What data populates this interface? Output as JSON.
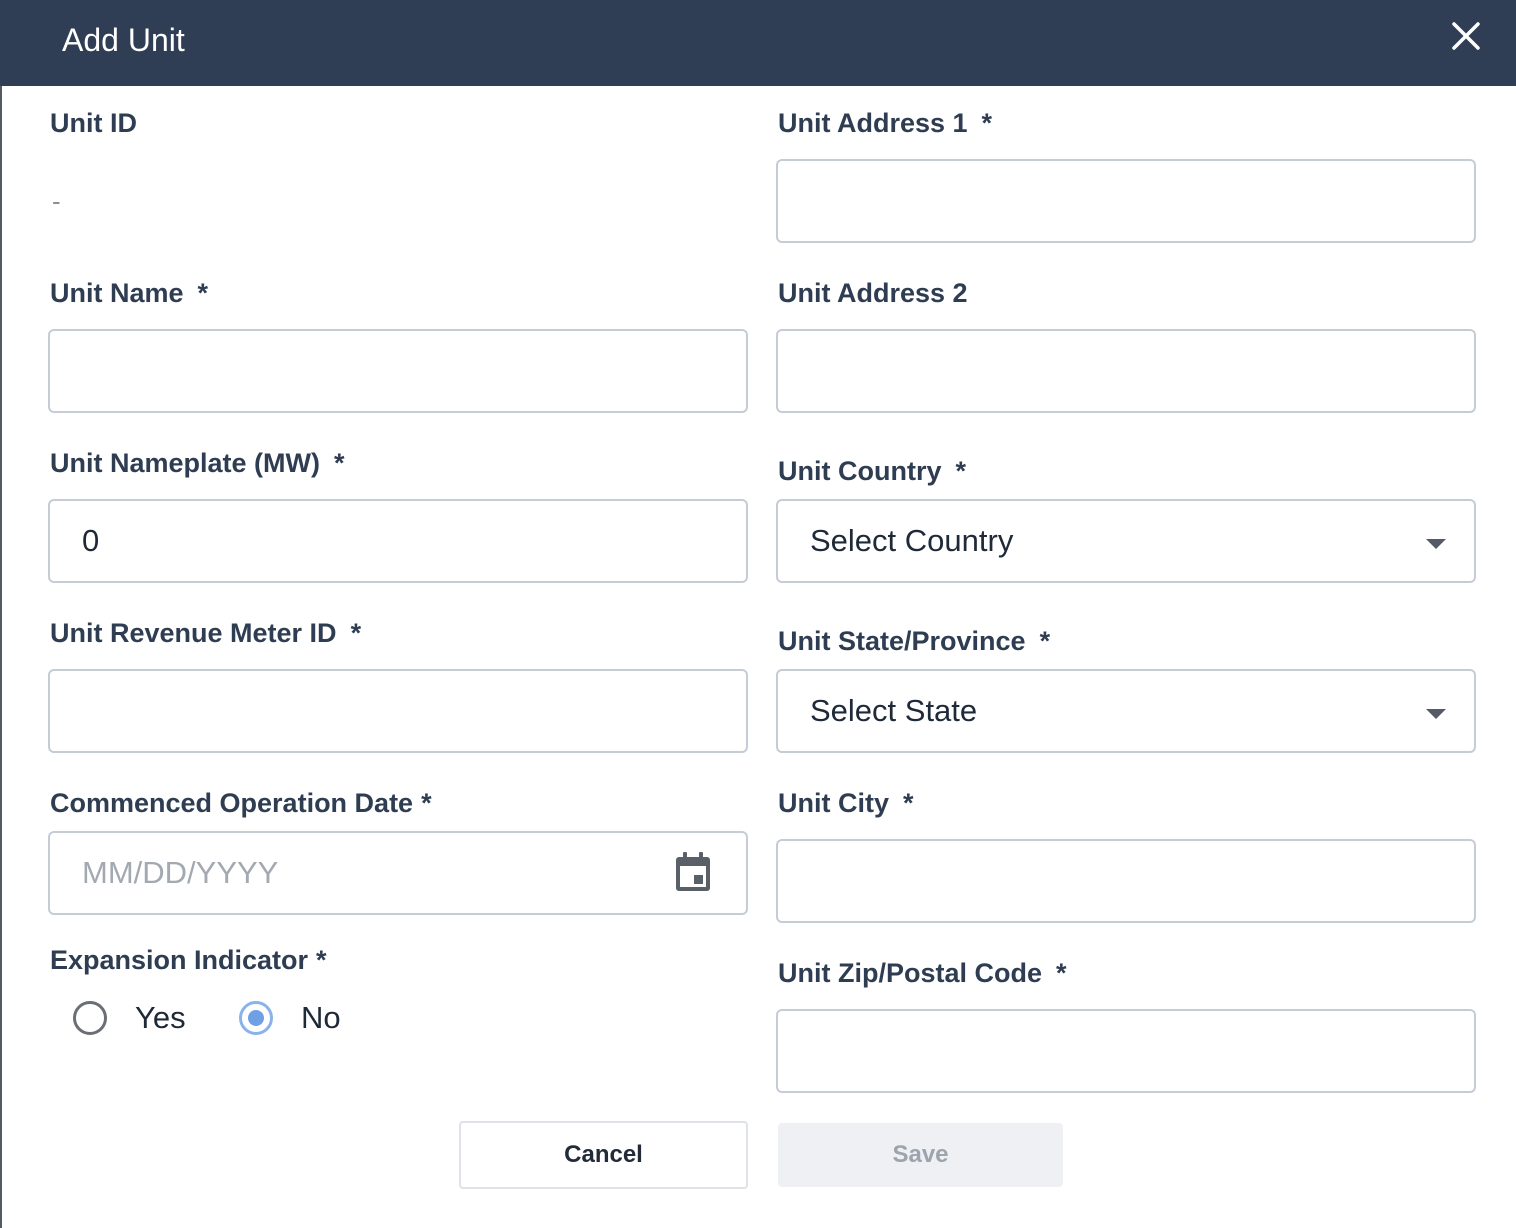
{
  "dialog": {
    "title": "Add Unit",
    "close_icon": "close-icon"
  },
  "left_column": {
    "unit_id": {
      "label": "Unit ID",
      "value": "-"
    },
    "unit_name": {
      "label": "Unit Name",
      "required": "*",
      "value": ""
    },
    "unit_nameplate": {
      "label": "Unit Nameplate (MW)",
      "required": "*",
      "value": "0"
    },
    "unit_revenue_meter_id": {
      "label": "Unit Revenue Meter ID",
      "required": "*",
      "value": ""
    },
    "commenced_operation_date": {
      "label": "Commenced Operation Date",
      "required": "*",
      "placeholder": "MM/DD/YYYY",
      "icon": "calendar-icon"
    },
    "expansion_indicator": {
      "label": "Expansion Indicator",
      "required": "*",
      "options": [
        {
          "label": "Yes",
          "selected": false
        },
        {
          "label": "No",
          "selected": true
        }
      ]
    }
  },
  "right_column": {
    "unit_address_1": {
      "label": "Unit Address 1",
      "required": "*",
      "value": ""
    },
    "unit_address_2": {
      "label": "Unit Address 2",
      "value": ""
    },
    "unit_country": {
      "label": "Unit Country",
      "required": "*",
      "selected": "Select Country",
      "icon": "chevron-down-icon"
    },
    "unit_state": {
      "label": "Unit State/Province",
      "required": "*",
      "selected": "Select State",
      "icon": "chevron-down-icon"
    },
    "unit_city": {
      "label": "Unit City",
      "required": "*",
      "value": ""
    },
    "unit_zip": {
      "label": "Unit Zip/Postal Code",
      "required": "*",
      "value": ""
    }
  },
  "actions": {
    "cancel_label": "Cancel",
    "save_label": "Save",
    "save_enabled": false
  },
  "colors": {
    "header_bg": "#2f3d55",
    "radio_accent": "#6fa0e6",
    "label_text": "#2f3d52"
  }
}
